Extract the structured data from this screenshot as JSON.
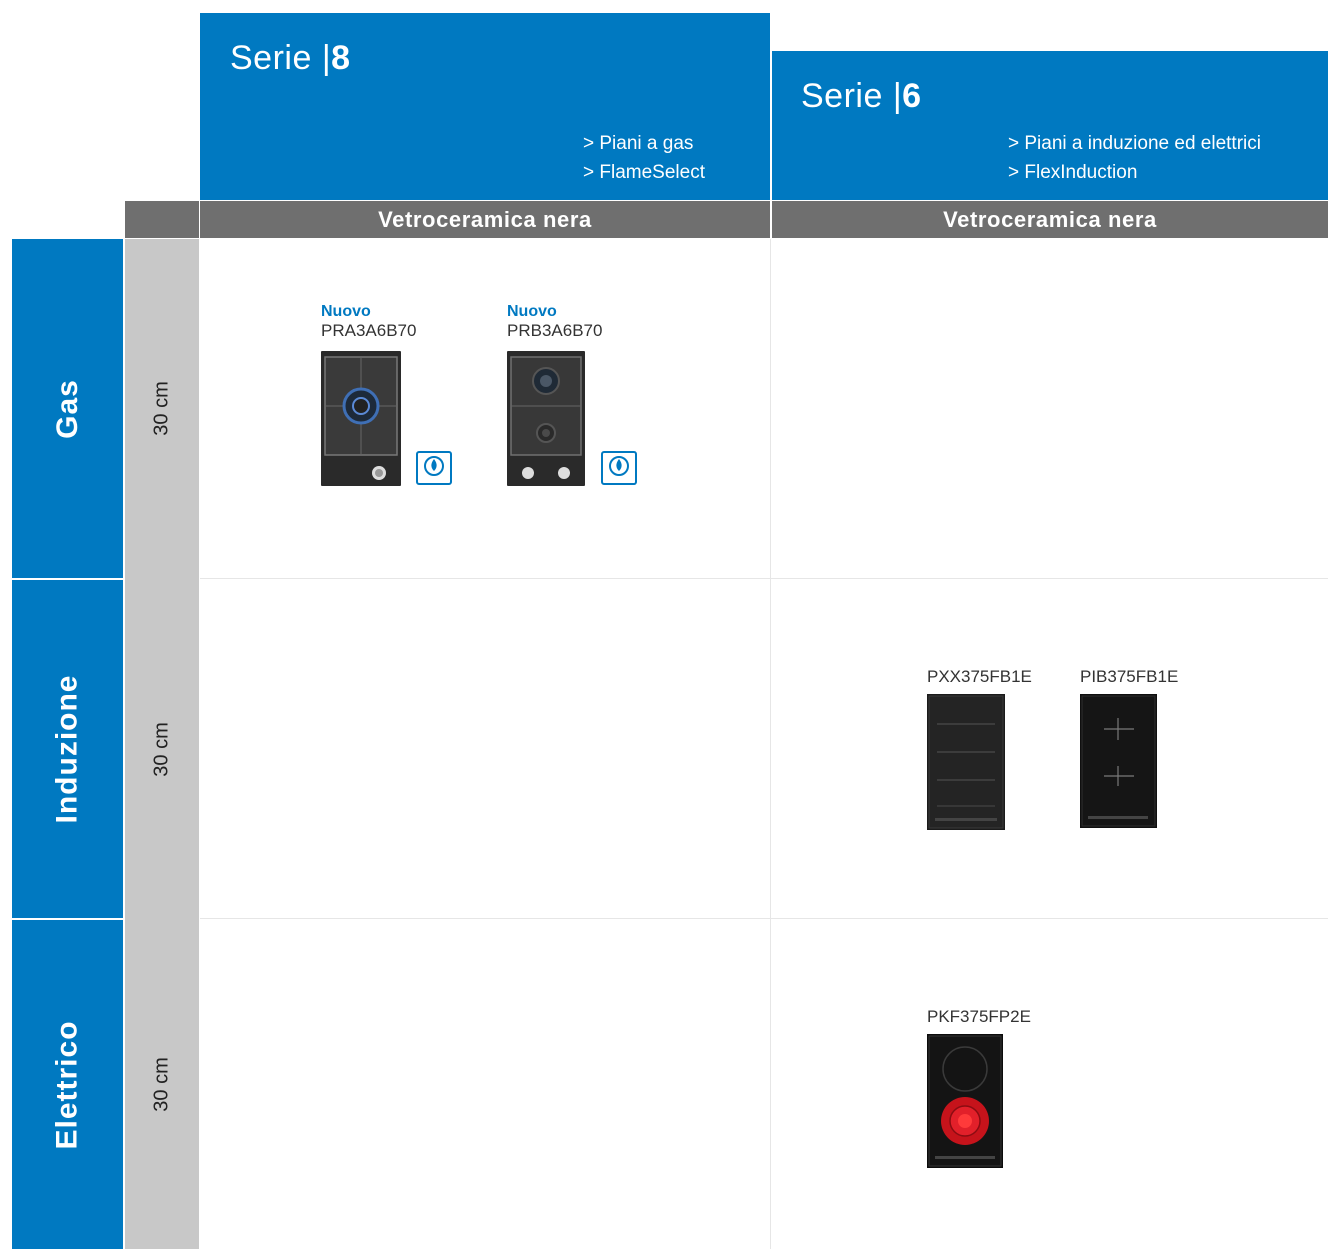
{
  "header": {
    "serie8": {
      "serie_word": "Serie",
      "separator": "|",
      "number": "8",
      "links": [
        "> Piani a gas",
        "> FlameSelect"
      ]
    },
    "serie6": {
      "serie_word": "Serie",
      "separator": "|",
      "number": "6",
      "links": [
        "> Piani a induzione ed elettrici",
        "> FlexInduction"
      ]
    }
  },
  "band": {
    "col1": "Vetroceramica nera",
    "col2": "Vetroceramica nera"
  },
  "rows": [
    {
      "category": "Gas",
      "size": "30 cm"
    },
    {
      "category": "Induzione",
      "size": "30 cm"
    },
    {
      "category": "Elettrico",
      "size": "30 cm"
    }
  ],
  "products": {
    "gas_1": {
      "badge": "Nuovo",
      "code": "PRA3A6B70",
      "logo_text": "FlameSelect"
    },
    "gas_2": {
      "badge": "Nuovo",
      "code": "PRB3A6B70",
      "logo_text": "FlameSelect"
    },
    "ind_1": {
      "code": "PXX375FB1E"
    },
    "ind_2": {
      "code": "PIB375FB1E"
    },
    "ele_1": {
      "code": "PKF375FP2E"
    }
  },
  "colors": {
    "brand_blue": "#0079c1",
    "band_dark": "#6f6f6f",
    "size_gray": "#c8c8c8"
  }
}
